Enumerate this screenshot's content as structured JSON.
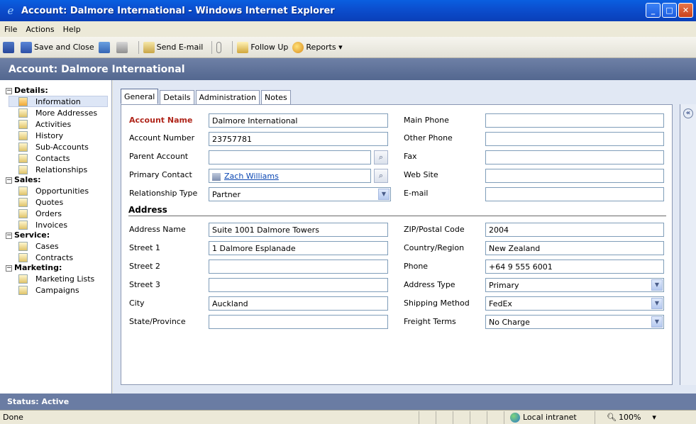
{
  "window": {
    "title": "Account: Dalmore International - Windows Internet Explorer"
  },
  "menu": {
    "file": "File",
    "actions": "Actions",
    "help": "Help"
  },
  "toolbar": {
    "save_close": "Save and Close",
    "send_email": "Send E-mail",
    "follow_up": "Follow Up",
    "reports": "Reports ▾"
  },
  "header": {
    "title": "Account: Dalmore International"
  },
  "nav": {
    "details_group": "Details:",
    "details_items": [
      "Information",
      "More Addresses",
      "Activities",
      "History",
      "Sub-Accounts",
      "Contacts",
      "Relationships"
    ],
    "sales_group": "Sales:",
    "sales_items": [
      "Opportunities",
      "Quotes",
      "Orders",
      "Invoices"
    ],
    "service_group": "Service:",
    "service_items": [
      "Cases",
      "Contracts"
    ],
    "marketing_group": "Marketing:",
    "marketing_items": [
      "Marketing Lists",
      "Campaigns"
    ]
  },
  "tabs": [
    "General",
    "Details",
    "Administration",
    "Notes"
  ],
  "form": {
    "account_name_label": "Account Name",
    "account_name": "Dalmore International",
    "account_number_label": "Account Number",
    "account_number": "23757781",
    "parent_account_label": "Parent Account",
    "parent_account": "",
    "primary_contact_label": "Primary Contact",
    "primary_contact": "Zach Williams",
    "relationship_type_label": "Relationship Type",
    "relationship_type": "Partner",
    "main_phone_label": "Main Phone",
    "main_phone": "",
    "other_phone_label": "Other Phone",
    "other_phone": "",
    "fax_label": "Fax",
    "fax": "",
    "web_site_label": "Web Site",
    "web_site": "",
    "email_label": "E-mail",
    "email": ""
  },
  "address": {
    "section_title": "Address",
    "address_name_label": "Address Name",
    "address_name": "Suite 1001 Dalmore Towers",
    "street1_label": "Street 1",
    "street1": "1 Dalmore Esplanade",
    "street2_label": "Street 2",
    "street2": "",
    "street3_label": "Street 3",
    "street3": "",
    "city_label": "City",
    "city": "Auckland",
    "state_label": "State/Province",
    "state": "",
    "zip_label": "ZIP/Postal Code",
    "zip": "2004",
    "country_label": "Country/Region",
    "country": "New Zealand",
    "phone_label": "Phone",
    "phone": "+64 9 555 6001",
    "address_type_label": "Address Type",
    "address_type": "Primary",
    "shipping_method_label": "Shipping Method",
    "shipping_method": "FedEx",
    "freight_terms_label": "Freight Terms",
    "freight_terms": "No Charge"
  },
  "status": {
    "label": "Status: Active"
  },
  "ie_status": {
    "done": "Done",
    "zone": "Local intranet",
    "zoom": "100%"
  }
}
